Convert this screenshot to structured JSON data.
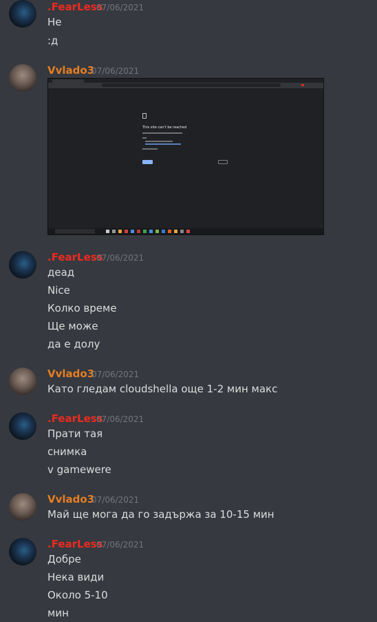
{
  "users": {
    "fearless": {
      "name": ".FearLess",
      "color": "#ed2a20"
    },
    "vvlado": {
      "name": "Vvlado3",
      "color": "#e67e22"
    }
  },
  "groups": [
    {
      "author": ".FearLess",
      "timestamp": "07/06/2021",
      "messages": [
        "Не",
        ":д"
      ]
    },
    {
      "author": "Vvlado3",
      "timestamp": "07/06/2021",
      "messages": [],
      "attachment": {
        "type": "screenshot",
        "error_title": "This site can't be reached",
        "url_text": "gamewere.com",
        "reload_label": "Reload",
        "details_label": "Details"
      }
    },
    {
      "author": ".FearLess",
      "timestamp": "07/06/2021",
      "messages": [
        "деад",
        "Nice",
        "Колко време",
        "Ще може",
        "да е долу"
      ]
    },
    {
      "author": "Vvlado3",
      "timestamp": "07/06/2021",
      "messages": [
        "Като гледам cloudshella още 1-2 мин макс"
      ]
    },
    {
      "author": ".FearLess",
      "timestamp": "07/06/2021",
      "messages": [
        "Прати тая",
        "снимка",
        "v gamewere"
      ]
    },
    {
      "author": "Vvlado3",
      "timestamp": "07/06/2021",
      "messages": [
        "Май ще мога да го задържа за 10-15 мин"
      ]
    },
    {
      "author": ".FearLess",
      "timestamp": "07/06/2021",
      "messages": [
        "Добре",
        "Нека види",
        "Около 5-10",
        "мин"
      ]
    }
  ],
  "colors": {
    "background": "#36393f",
    "text": "#dcddde",
    "timestamp": "#72767d"
  }
}
